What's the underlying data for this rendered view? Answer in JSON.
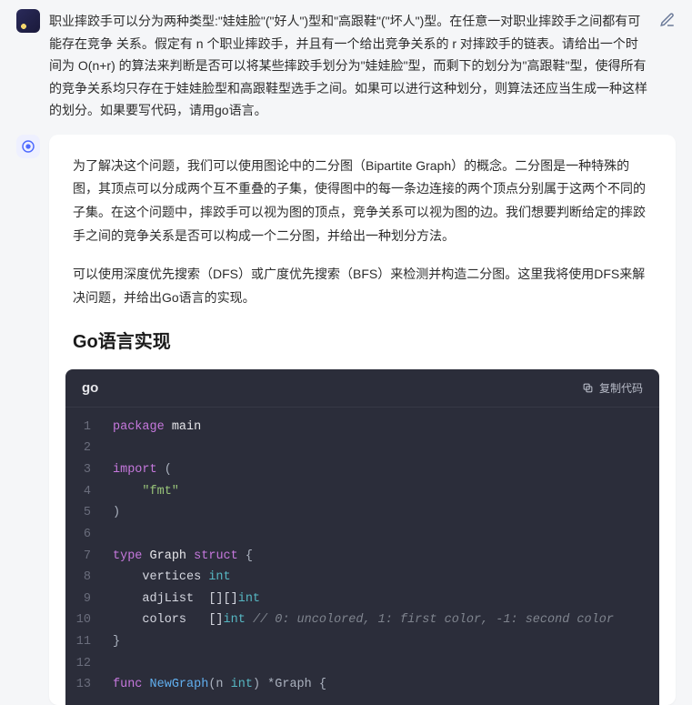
{
  "user_message": "职业摔跤手可以分为两种类型:\"娃娃脸\"(\"好人\")型和\"高跟鞋\"(\"坏人\")型。在任意一对职业摔跤手之间都有可能存在竞争 关系。假定有 n 个职业摔跤手，并且有一个给出竞争关系的 r 对摔跤手的链表。请给出一个时间为 O(n+r) 的算法来判断是否可以将某些摔跤手划分为\"娃娃脸\"型，而剩下的划分为\"高跟鞋\"型，使得所有的竞争关系均只存在于娃娃脸型和高跟鞋型选手之间。如果可以进行这种划分，则算法还应当生成一种这样的划分。如果要写代码，请用go语言。",
  "assistant": {
    "para1": "为了解决这个问题，我们可以使用图论中的二分图（Bipartite Graph）的概念。二分图是一种特殊的图，其顶点可以分成两个互不重叠的子集，使得图中的每一条边连接的两个顶点分别属于这两个不同的子集。在这个问题中，摔跤手可以视为图的顶点，竞争关系可以视为图的边。我们想要判断给定的摔跤手之间的竞争关系是否可以构成一个二分图，并给出一种划分方法。",
    "para2": "可以使用深度优先搜索（DFS）或广度优先搜索（BFS）来检测并构造二分图。这里我将使用DFS来解决问题，并给出Go语言的实现。",
    "section_title": "Go语言实现"
  },
  "code": {
    "lang": "go",
    "copy_label": "复制代码",
    "lines": [
      {
        "n": 1,
        "tokens": [
          [
            "kw",
            "package"
          ],
          [
            "pkg",
            " main"
          ]
        ]
      },
      {
        "n": 2,
        "tokens": []
      },
      {
        "n": 3,
        "tokens": [
          [
            "kw",
            "import"
          ],
          [
            "punct",
            " ("
          ]
        ]
      },
      {
        "n": 4,
        "tokens": [
          [
            "plain",
            "    "
          ],
          [
            "str",
            "\"fmt\""
          ]
        ]
      },
      {
        "n": 5,
        "tokens": [
          [
            "punct",
            ")"
          ]
        ]
      },
      {
        "n": 6,
        "tokens": []
      },
      {
        "n": 7,
        "tokens": [
          [
            "kw",
            "type"
          ],
          [
            "plain",
            " "
          ],
          [
            "ident",
            "Graph"
          ],
          [
            "plain",
            " "
          ],
          [
            "kw",
            "struct"
          ],
          [
            "punct",
            " {"
          ]
        ]
      },
      {
        "n": 8,
        "tokens": [
          [
            "plain",
            "    vertices "
          ],
          [
            "type",
            "int"
          ]
        ]
      },
      {
        "n": 9,
        "tokens": [
          [
            "plain",
            "    adjList  [][]"
          ],
          [
            "type",
            "int"
          ]
        ]
      },
      {
        "n": 10,
        "tokens": [
          [
            "plain",
            "    colors   []"
          ],
          [
            "type",
            "int"
          ],
          [
            "plain",
            " "
          ],
          [
            "comment",
            "// 0: uncolored, 1: first color, -1: second color"
          ]
        ]
      },
      {
        "n": 11,
        "tokens": [
          [
            "punct",
            "}"
          ]
        ]
      },
      {
        "n": 12,
        "tokens": []
      },
      {
        "n": 13,
        "tokens": [
          [
            "kw",
            "func"
          ],
          [
            "plain",
            " "
          ],
          [
            "fn",
            "NewGraph"
          ],
          [
            "punct",
            "(n "
          ],
          [
            "type",
            "int"
          ],
          [
            "punct",
            ") *Graph {"
          ]
        ]
      }
    ]
  }
}
